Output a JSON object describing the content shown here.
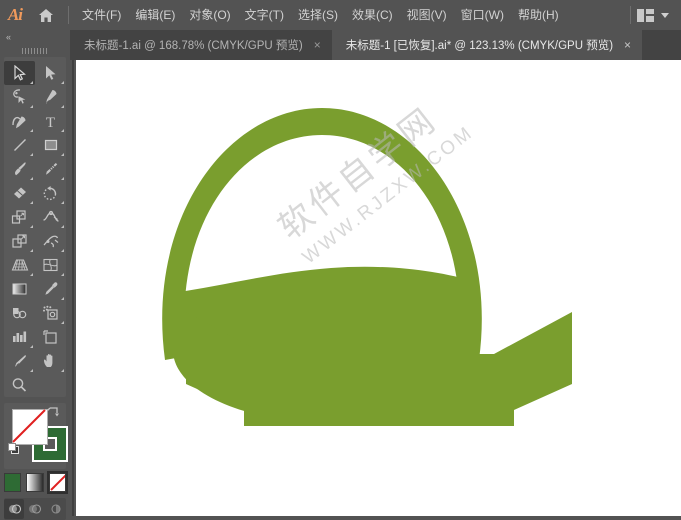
{
  "app": {
    "name": "Adobe Illustrator",
    "logo_text": "Ai",
    "home_icon": "home-icon"
  },
  "menubar": {
    "items": [
      {
        "label": "文件(F)",
        "name": "menu-file"
      },
      {
        "label": "编辑(E)",
        "name": "menu-edit"
      },
      {
        "label": "对象(O)",
        "name": "menu-object"
      },
      {
        "label": "文字(T)",
        "name": "menu-type"
      },
      {
        "label": "选择(S)",
        "name": "menu-select"
      },
      {
        "label": "效果(C)",
        "name": "menu-effect"
      },
      {
        "label": "视图(V)",
        "name": "menu-view"
      },
      {
        "label": "窗口(W)",
        "name": "menu-window"
      },
      {
        "label": "帮助(H)",
        "name": "menu-help"
      }
    ],
    "workspace_icon": "workspace-switcher-icon",
    "workspace_chevron": "chevron-down-icon"
  },
  "tabs": [
    {
      "label": "未标题-1.ai @ 168.78% (CMYK/GPU 预览)",
      "close": "×",
      "active": false,
      "document_name": "未标题-1.ai",
      "zoom": "168.78%",
      "mode": "CMYK/GPU 预览"
    },
    {
      "label": "未标题-1 [已恢复].ai* @ 123.13% (CMYK/GPU 预览)",
      "close": "×",
      "active": true,
      "document_name": "未标题-1 [已恢复].ai*",
      "zoom": "123.13%",
      "mode": "CMYK/GPU 预览"
    }
  ],
  "toolpanel": {
    "collapse_label": "«",
    "grip": "panel-grip",
    "tools": [
      {
        "name": "selection-tool",
        "selected": true,
        "corner": true
      },
      {
        "name": "direct-selection-tool",
        "selected": false,
        "corner": true
      },
      {
        "name": "magic-wand-tool",
        "selected": false,
        "corner": true
      },
      {
        "name": "pen-tool",
        "selected": false,
        "corner": true
      },
      {
        "name": "curvature-tool",
        "selected": false,
        "corner": true
      },
      {
        "name": "type-tool",
        "selected": false,
        "corner": true
      },
      {
        "name": "line-segment-tool",
        "selected": false,
        "corner": true
      },
      {
        "name": "rectangle-tool",
        "selected": false,
        "corner": true
      },
      {
        "name": "paintbrush-tool",
        "selected": false,
        "corner": true
      },
      {
        "name": "shaper-tool",
        "selected": false,
        "corner": true
      },
      {
        "name": "eraser-tool",
        "selected": false,
        "corner": true
      },
      {
        "name": "rotate-tool",
        "selected": false,
        "corner": true
      },
      {
        "name": "scale-tool",
        "selected": false,
        "corner": true
      },
      {
        "name": "width-tool",
        "selected": false,
        "corner": true
      },
      {
        "name": "free-transform-tool",
        "selected": false,
        "corner": true
      },
      {
        "name": "shape-builder-tool",
        "selected": false,
        "corner": true
      },
      {
        "name": "perspective-grid-tool",
        "selected": false,
        "corner": true
      },
      {
        "name": "mesh-tool",
        "selected": false,
        "corner": true
      },
      {
        "name": "gradient-tool",
        "selected": false,
        "corner": false
      },
      {
        "name": "eyedropper-tool",
        "selected": false,
        "corner": true
      },
      {
        "name": "blend-tool",
        "selected": false,
        "corner": false
      },
      {
        "name": "symbol-sprayer-tool",
        "selected": false,
        "corner": true
      },
      {
        "name": "column-graph-tool",
        "selected": false,
        "corner": true
      },
      {
        "name": "artboard-tool",
        "selected": false,
        "corner": false
      },
      {
        "name": "slice-tool",
        "selected": false,
        "corner": true
      },
      {
        "name": "hand-tool",
        "selected": false,
        "corner": true
      },
      {
        "name": "zoom-tool",
        "selected": false,
        "corner": false
      }
    ],
    "fill": {
      "name": "fill-swatch",
      "value": "none",
      "color": "#ffffff"
    },
    "stroke": {
      "name": "stroke-swatch",
      "value": "green",
      "color": "#2e6b34"
    },
    "swap": "swap-fill-stroke-icon",
    "default": "default-fill-stroke-icon",
    "modes": [
      {
        "name": "color-mode-button",
        "active": false,
        "color": "#2e6b34"
      },
      {
        "name": "gradient-mode-button",
        "active": false
      },
      {
        "name": "none-mode-button",
        "active": true
      }
    ],
    "draw_modes": [
      {
        "name": "draw-normal-button",
        "active": true
      },
      {
        "name": "draw-behind-button",
        "active": false
      },
      {
        "name": "draw-inside-button",
        "active": false
      }
    ]
  },
  "canvas": {
    "name": "artboard-canvas",
    "background": "#ffffff",
    "artwork": {
      "name": "basket-banner-logo",
      "description": "绿色篮子与丝带徽标",
      "fill_color": "#7a9e2e"
    },
    "watermark": {
      "line1": "软件自学网",
      "line2": "WWW.RJZXW.COM",
      "color": "#b9b9b9"
    }
  },
  "colors": {
    "chrome": "#535353",
    "chrome_dark": "#434343",
    "panel": "#5a5a5a",
    "accent_green": "#7a9e2e",
    "stroke_green": "#2e6b34",
    "text": "#d2d2d2"
  }
}
